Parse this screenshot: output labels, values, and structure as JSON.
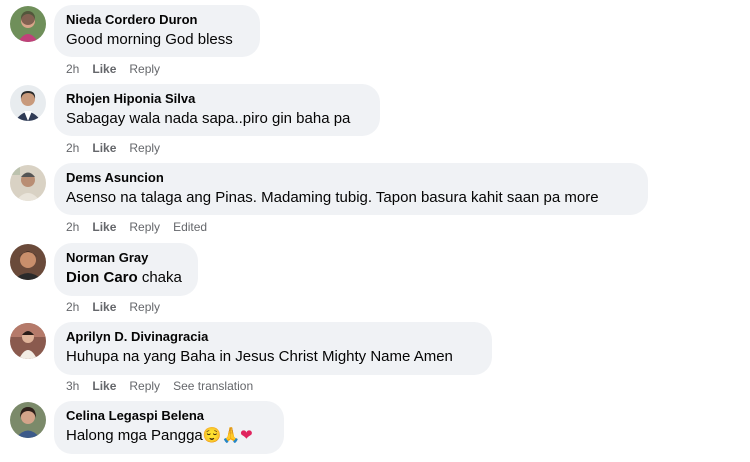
{
  "comments": [
    {
      "author": "Nieda Cordero Duron",
      "text": "Good morning God bless",
      "time": "2h",
      "like": "Like",
      "reply": "Reply"
    },
    {
      "author": "Rhojen Hiponia Silva",
      "text": "Sabagay wala nada sapa..piro gin baha pa",
      "time": "2h",
      "like": "Like",
      "reply": "Reply"
    },
    {
      "author": "Dems Asuncion",
      "text": "Asenso na talaga ang Pinas. Madaming tubig. Tapon basura kahit saan pa more",
      "time": "2h",
      "like": "Like",
      "reply": "Reply",
      "extra": "Edited"
    },
    {
      "author": "Norman Gray",
      "mention": "Dion Caro",
      "text": " chaka",
      "time": "2h",
      "like": "Like",
      "reply": "Reply"
    },
    {
      "author": "Aprilyn D. Divinagracia",
      "text": "Huhupa na yang Baha in Jesus Christ Mighty Name Amen",
      "time": "3h",
      "like": "Like",
      "reply": "Reply",
      "extra": "See translation"
    },
    {
      "author": "Celina Legaspi Belena",
      "text": "Halong mga Pangga",
      "emojis": [
        "😌",
        "🙏",
        "❤"
      ],
      "time": "",
      "like": "",
      "reply": ""
    }
  ],
  "icons": [
    "avatar-nieda",
    "avatar-rhojen",
    "avatar-dems",
    "avatar-norman",
    "avatar-aprilyn",
    "avatar-celina"
  ]
}
